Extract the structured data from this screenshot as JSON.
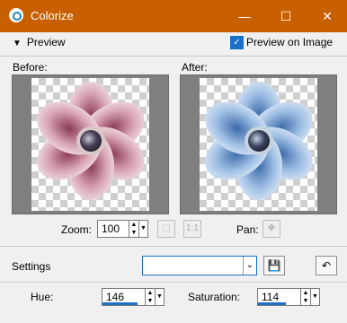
{
  "window": {
    "title": "Colorize",
    "minimize": "—",
    "maximize": "☐",
    "close": "✕",
    "accent": "#c85f00"
  },
  "preview": {
    "toggle_label": "Preview",
    "checkbox_label": "Preview on Image",
    "checked": true,
    "before_label": "Before:",
    "after_label": "After:"
  },
  "zoom": {
    "label": "Zoom:",
    "value": "100",
    "pan_label": "Pan:"
  },
  "settings": {
    "label": "Settings",
    "combo_value": ""
  },
  "params": {
    "hue_label": "Hue:",
    "hue_value": "146",
    "hue_fill_fraction": 0.57,
    "saturation_label": "Saturation:",
    "saturation_value": "114",
    "saturation_fill_fraction": 0.45
  },
  "icons": {
    "app": "colorize-app-icon",
    "save": "save-icon",
    "reset": "reset-icon",
    "zoom_fit": "zoom-fit-icon",
    "zoom_actual": "zoom-actual-icon",
    "pan": "pan-move-icon"
  }
}
